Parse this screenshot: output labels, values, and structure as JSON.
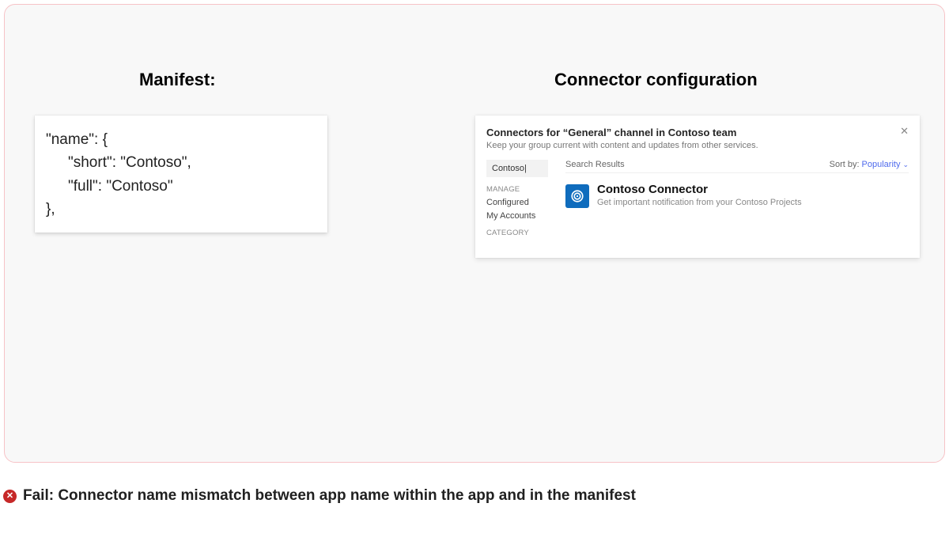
{
  "headings": {
    "manifest": "Manifest:",
    "connector": "Connector configuration"
  },
  "manifest": {
    "line1": "\"name\": {",
    "line2": "\"short\": \"Contoso\",",
    "line3": "\"full\": \"Contoso\"",
    "line4": "},"
  },
  "connector": {
    "title": "Connectors for “General” channel in Contoso team",
    "subtitle": "Keep your group current with content and updates from other services.",
    "search_value": "Contoso|",
    "sidebar": {
      "section1_head": "MANAGE",
      "item_configured": "Configured",
      "item_accounts": "My Accounts",
      "section2_head": "CATEGORY"
    },
    "results": {
      "label": "Search Results",
      "sort_prefix": "Sort by:",
      "sort_value": "Popularity",
      "item_name": "Contoso Connector",
      "item_desc": "Get important notification from your Contoso Projects"
    }
  },
  "fail": {
    "badge": "✕",
    "text": "Fail: Connector name mismatch between app name within the app and in the manifest"
  }
}
